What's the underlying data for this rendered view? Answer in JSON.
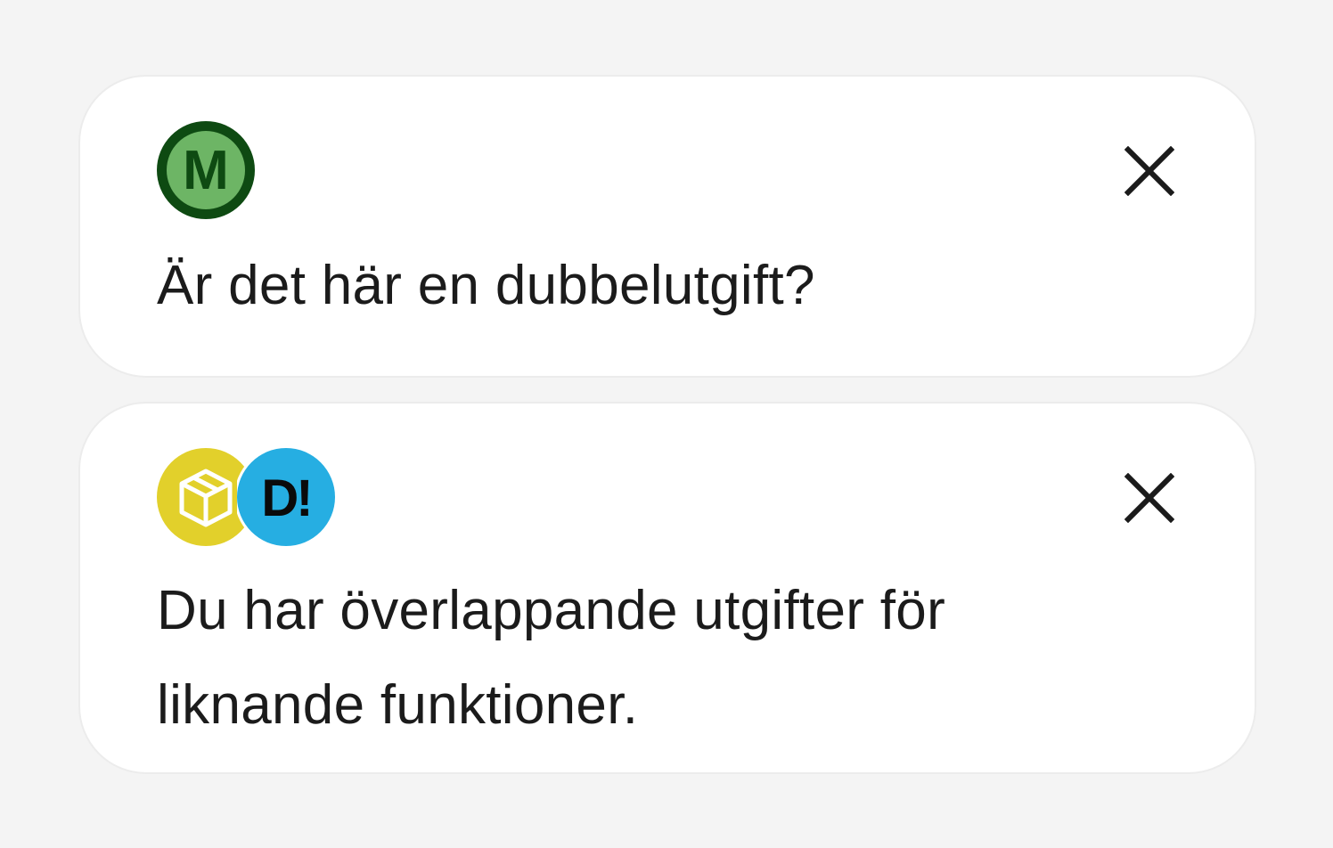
{
  "colors": {
    "background": "#f4f4f4",
    "card": "#ffffff",
    "text": "#1b1b1b",
    "metro_outer": "#0e4a12",
    "metro_inner": "#6db565",
    "box_app": "#e2d02b",
    "di_app": "#26aee2"
  },
  "cards": [
    {
      "icons": [
        "metro-logo-icon"
      ],
      "icon_letters": [
        "M"
      ],
      "message": "Är det här en dubbelutgift?",
      "close_icon": "close-icon"
    },
    {
      "icons": [
        "box-app-icon",
        "di-logo-icon"
      ],
      "icon_letters": [
        "",
        "D!"
      ],
      "message": "Du har överlappande utgifter för liknande funktioner.",
      "close_icon": "close-icon"
    }
  ]
}
